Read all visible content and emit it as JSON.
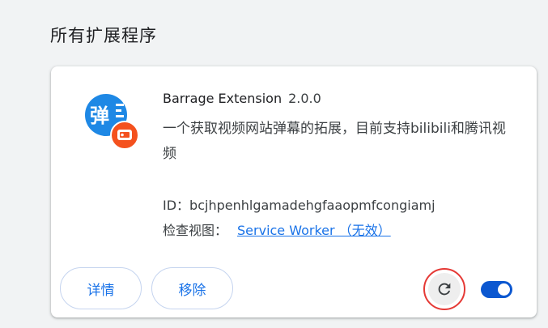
{
  "section": {
    "title": "所有扩展程序"
  },
  "extension": {
    "icon_char": "弹",
    "name": "Barrage Extension",
    "version": "2.0.0",
    "description": "一个获取视频网站弹幕的拓展，目前支持bilibili和腾讯视频",
    "id_label": "ID：",
    "id_value": "bcjhpenhlgamadehgfaaopmfcongiamj",
    "views_label": "检查视图：",
    "views_link": "Service Worker （无效）",
    "enabled": true
  },
  "buttons": {
    "details": "详情",
    "remove": "移除"
  },
  "colors": {
    "accent": "#1a73e8",
    "toggle": "#0b57d0",
    "icon_blue": "#1e88e5",
    "icon_badge": "#f4511e",
    "highlight_ring": "#e53935"
  }
}
